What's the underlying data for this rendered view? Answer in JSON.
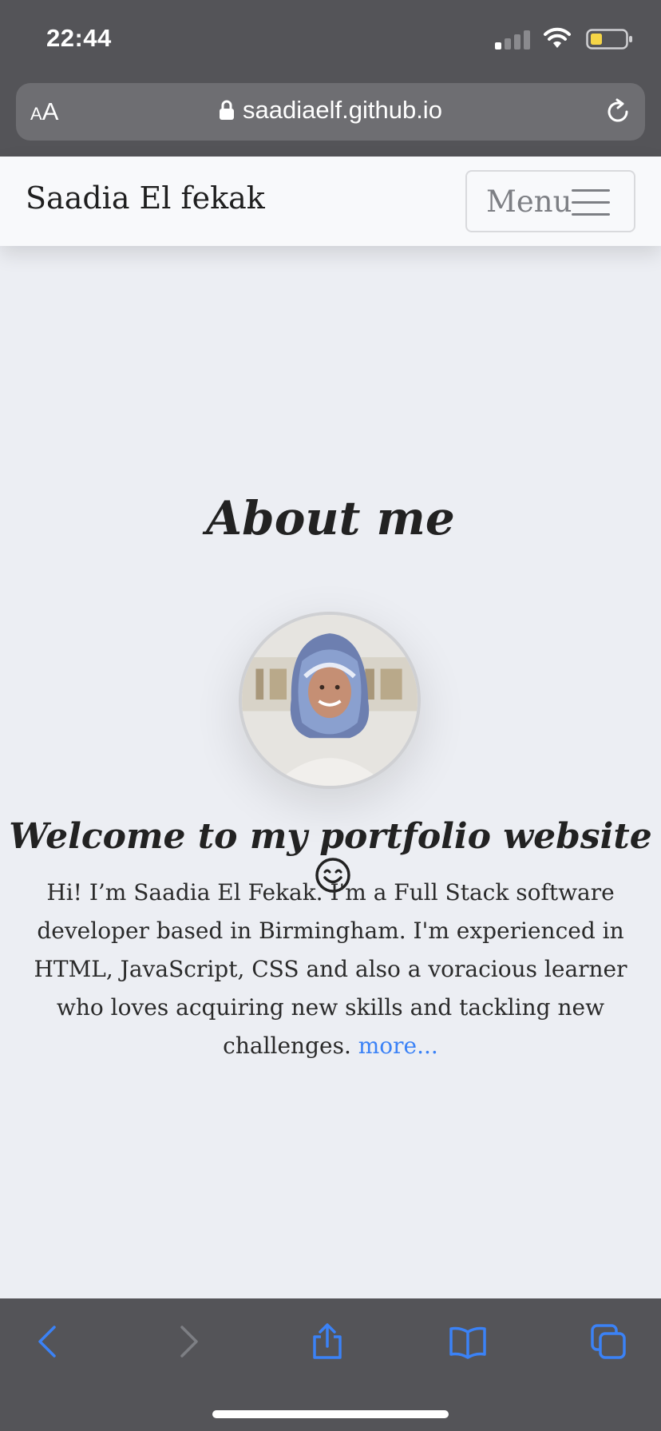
{
  "status_bar": {
    "time": "22:44"
  },
  "browser": {
    "text_size_small": "A",
    "text_size_large": "A",
    "url": "saadiaelf.github.io"
  },
  "navbar": {
    "brand": "Saadia El fekak",
    "menu_label": "Menu"
  },
  "about": {
    "title": "About me",
    "welcome": "Welcome to my portfolio website",
    "intro": "Hi! I’m Saadia El Fekak. I'm a Full Stack software developer based in Birmingham. I'm experienced in HTML, JavaScript, CSS and also a voracious learner who loves acquiring new skills and tackling new challenges. ",
    "more_link": "more..."
  },
  "colors": {
    "chrome": "#545458",
    "page_bg": "#eceef3",
    "link": "#3b82f6",
    "battery_level": "#f5d547",
    "toolbar_active": "#3b82f6",
    "toolbar_disabled": "#7d7f84"
  },
  "icons": [
    "lock-icon",
    "reload-icon",
    "hamburger-icon",
    "smile-icon",
    "back-icon",
    "forward-icon",
    "share-icon",
    "bookmarks-icon",
    "tabs-icon"
  ]
}
